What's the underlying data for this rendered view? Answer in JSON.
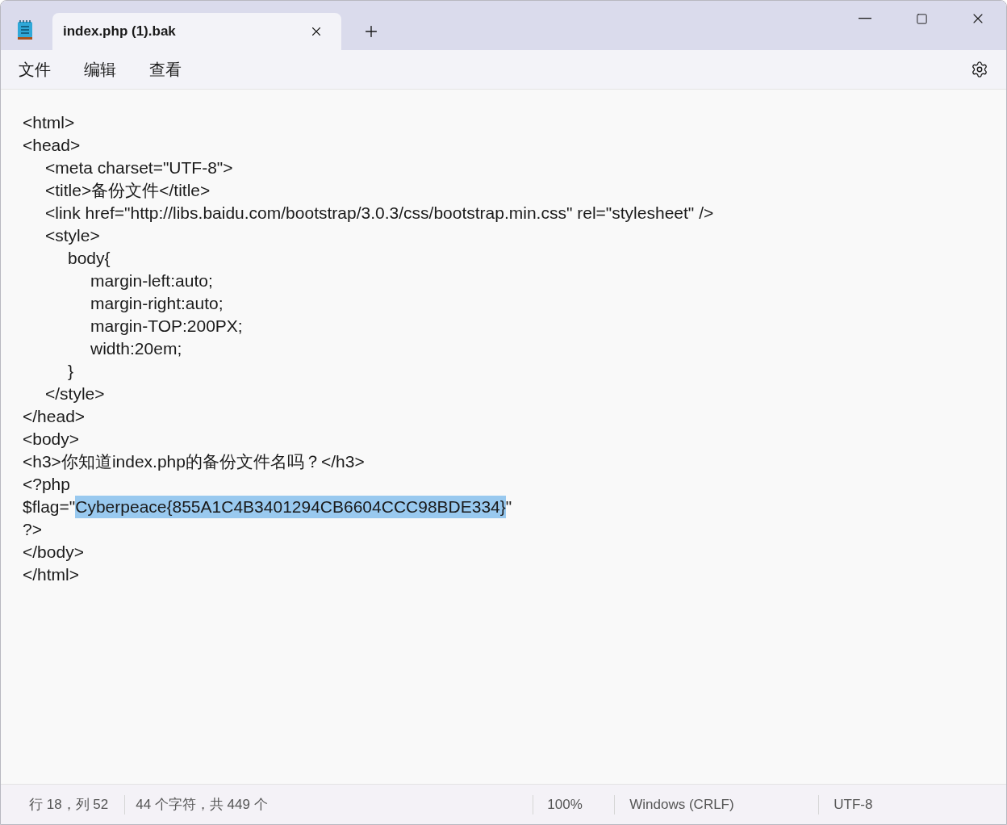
{
  "tabs": [
    {
      "label": "index.php (1).bak",
      "selected": true
    }
  ],
  "menu": [
    "文件",
    "编辑",
    "查看"
  ],
  "lines": [
    {
      "text": "<html>"
    },
    {
      "text": "<head>",
      "children": [
        {
          "text": "<meta charset=\"UTF-8\">"
        },
        {
          "text": "<title>备份文件</title>"
        },
        {
          "text": "<link href=\"http://libs.baidu.com/bootstrap/3.0.3/css/bootstrap.min.css\" rel=\"stylesheet\" />"
        },
        {
          "text": "<style>",
          "children": [
            {
              "text": "body{",
              "children": [
                {
                  "text": "margin-left:auto;"
                },
                {
                  "text": "margin-right:auto;"
                },
                {
                  "text": "margin-TOP:200PX;"
                },
                {
                  "text": "width:20em;"
                }
              ]
            },
            {
              "text": "}"
            }
          ]
        },
        {
          "text": "</style>"
        }
      ]
    },
    {
      "text": "</head>"
    },
    {
      "text": "<body>"
    },
    {
      "text": "<h3>你知道index.php的备份文件名吗？</h3>"
    },
    {
      "text": "<?php"
    },
    {
      "segments": [
        {
          "text": "$flag=\"",
          "selected": false
        },
        {
          "text": "Cyberpeace{855A1C4B3401294CB6604CCC98BDE334}",
          "selected": true
        },
        {
          "text": "\"",
          "selected": false
        }
      ]
    },
    {
      "text": "?>"
    },
    {
      "text": "</body>"
    },
    {
      "text": "</html>"
    }
  ],
  "status_bar": {
    "position": "行 18，列 52",
    "selection": "44 个字符，共 449 个",
    "zoom": "100%",
    "line_ending": "Windows (CRLF)",
    "encoding": "UTF-8"
  }
}
